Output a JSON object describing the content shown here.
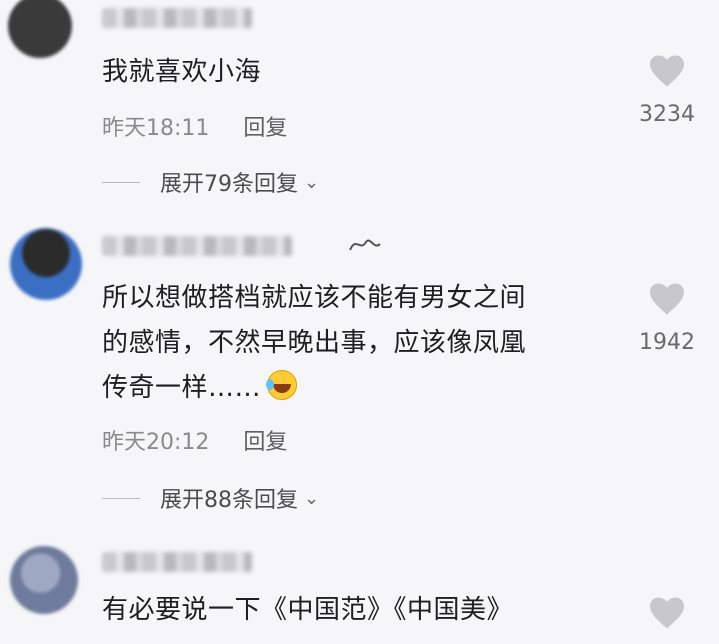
{
  "comments": [
    {
      "text_lines": [
        "我就喜欢小海"
      ],
      "time": "昨天18:11",
      "reply_label": "回复",
      "likes": "3234",
      "expand_label": "展开79条回复"
    },
    {
      "text_lines": [
        "所以想做搭档就应该不能有男女之间",
        "的感情，不然早晚出事，应该像凤凰",
        "传奇一样……"
      ],
      "time": "昨天20:12",
      "reply_label": "回复",
      "likes": "1942",
      "expand_label": "展开88条回复"
    },
    {
      "text_lines": [
        "有必要说一下《中国范》《中国美》"
      ],
      "likes": ""
    }
  ],
  "icons": {
    "like": "heart-icon",
    "expand": "chevron-down-icon",
    "emoji": "laughing-tears-emoji"
  },
  "colors": {
    "background": "#f6f6f8",
    "heart": "#c8c8cc",
    "meta": "#8a8a8e"
  }
}
